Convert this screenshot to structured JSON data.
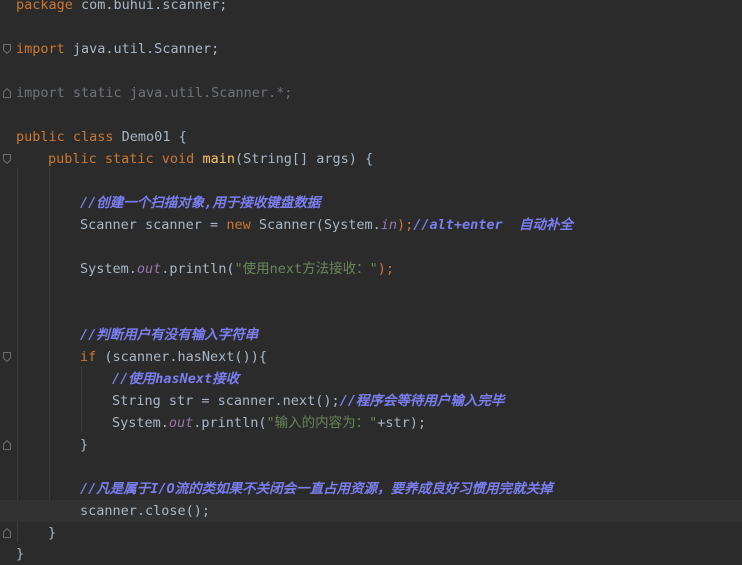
{
  "code": {
    "package_kw": "package",
    "package_name": " com.buhui.scanner;",
    "import_kw": "import",
    "import1_rest": " java.util.Scanner;",
    "import2_text": "import static java.util.Scanner.*;",
    "class_mods": "public class",
    "class_name": " Demo01 {",
    "main_mods": "public static void",
    "main_name": "main",
    "main_params": "(String[] args) {",
    "comment_create": "//创建一个扫描对象,用于接收键盘数据",
    "scanner_decl": "Scanner scanner = ",
    "new_kw": "new",
    "scanner_ctor": " Scanner(System.",
    "in_field": "in",
    "ctor_close": ");",
    "comment_autocomplete": "//alt+enter  自动补全",
    "print1_prefix": "System.",
    "out_field": "out",
    "print1_call": ".println(",
    "print1_str": "\"使用next方法接收：\"",
    "print1_close": ");",
    "comment_check": "//判断用户有没有输入字符串",
    "if_kw": "if",
    "if_cond": " (scanner.hasNext()){",
    "comment_use_next": "//使用hasNext接收",
    "str_decl": "String str = scanner.next();",
    "comment_wait": "//程序会等待用户输入完毕",
    "print2_prefix": "System.",
    "print2_call": ".println(",
    "print2_str": "\"输入的内容为：\"",
    "print2_rest": "+str);",
    "close_brace_inner": "}",
    "comment_io": "//凡是属于I/O流的类如果不关闭会一直占用资源，要养成良好习惯用完就关掉",
    "close_call": "scanner.close();",
    "close_brace_method": "}",
    "close_brace_class": "}"
  },
  "colors": {
    "background": "#2b2b2b",
    "keyword": "#cc7832",
    "method_name": "#ffc66d",
    "string": "#6a8759",
    "static_field": "#9876aa",
    "comment": "#7a7ef0",
    "plain": "#a9b7c6"
  }
}
